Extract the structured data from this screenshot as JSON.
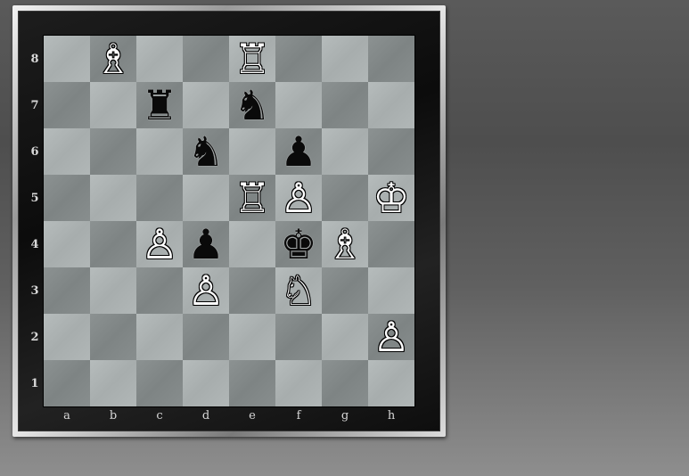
{
  "board": {
    "files": [
      "a",
      "b",
      "c",
      "d",
      "e",
      "f",
      "g",
      "h"
    ],
    "ranks": [
      "8",
      "7",
      "6",
      "5",
      "4",
      "3",
      "2",
      "1"
    ],
    "colors": {
      "light_square": "#b1b7b7",
      "dark_square": "#868c8c",
      "frame": "#141414"
    },
    "pieces": [
      {
        "square": "b8",
        "color": "white",
        "type": "bishop",
        "glyph": "♗"
      },
      {
        "square": "e8",
        "color": "white",
        "type": "rook",
        "glyph": "♖"
      },
      {
        "square": "c7",
        "color": "black",
        "type": "rook",
        "glyph": "♜"
      },
      {
        "square": "e7",
        "color": "black",
        "type": "knight",
        "glyph": "♞"
      },
      {
        "square": "d6",
        "color": "black",
        "type": "knight",
        "glyph": "♞"
      },
      {
        "square": "f6",
        "color": "black",
        "type": "pawn",
        "glyph": "♟"
      },
      {
        "square": "e5",
        "color": "white",
        "type": "rook",
        "glyph": "♖"
      },
      {
        "square": "f5",
        "color": "white",
        "type": "pawn",
        "glyph": "♙"
      },
      {
        "square": "h5",
        "color": "white",
        "type": "king",
        "glyph": "♔"
      },
      {
        "square": "c4",
        "color": "white",
        "type": "pawn",
        "glyph": "♙"
      },
      {
        "square": "d4",
        "color": "black",
        "type": "pawn",
        "glyph": "♟"
      },
      {
        "square": "f4",
        "color": "black",
        "type": "king",
        "glyph": "♚"
      },
      {
        "square": "g4",
        "color": "white",
        "type": "bishop",
        "glyph": "♗"
      },
      {
        "square": "d3",
        "color": "white",
        "type": "pawn",
        "glyph": "♙"
      },
      {
        "square": "f3",
        "color": "white",
        "type": "knight",
        "glyph": "♘"
      },
      {
        "square": "h2",
        "color": "white",
        "type": "pawn",
        "glyph": "♙"
      }
    ]
  }
}
